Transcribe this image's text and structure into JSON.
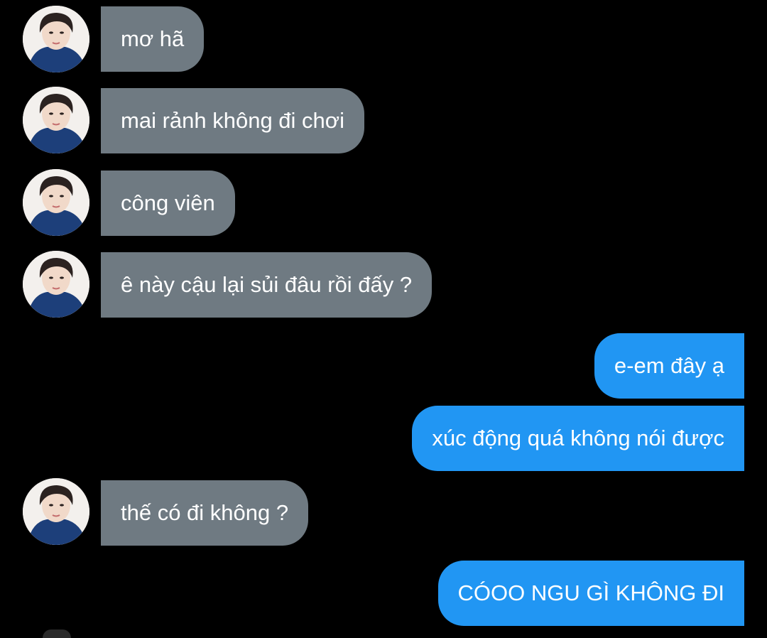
{
  "colors": {
    "background": "#000000",
    "incoming_bubble": "#6f7a82",
    "outgoing_bubble": "#2196f3",
    "text": "#ffffff"
  },
  "messages": [
    {
      "sender": "other",
      "text": "mơ hã"
    },
    {
      "sender": "other",
      "text": "mai rảnh không đi chơi"
    },
    {
      "sender": "other",
      "text": "công viên"
    },
    {
      "sender": "other",
      "text": "ê này cậu lại sủi đâu rồi đấy ?"
    },
    {
      "sender": "me",
      "text": "e-em đây ạ"
    },
    {
      "sender": "me",
      "text": "xúc động quá không nói được"
    },
    {
      "sender": "other",
      "text": "thế có đi không ?"
    },
    {
      "sender": "me",
      "text": "CÓOO NGU GÌ KHÔNG ĐI"
    }
  ]
}
